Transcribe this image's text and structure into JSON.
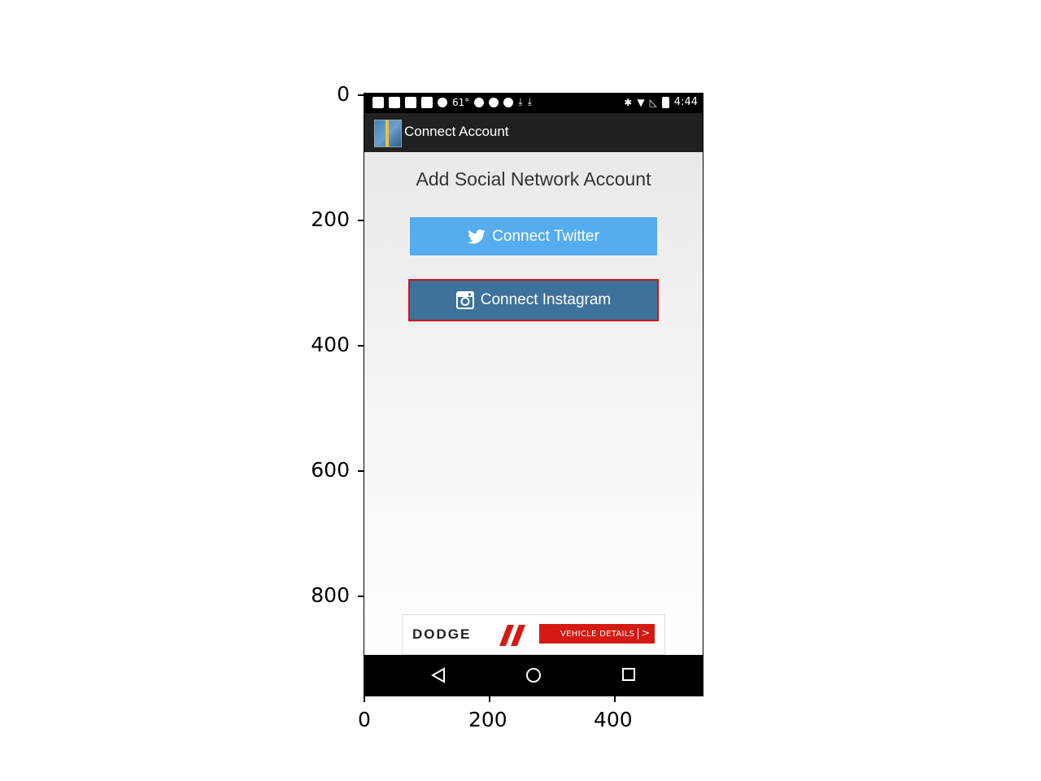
{
  "axes": {
    "y_ticks": [
      "0",
      "200",
      "400",
      "600",
      "800"
    ],
    "x_ticks": [
      "0",
      "200",
      "400"
    ]
  },
  "status_bar": {
    "temperature": "61°",
    "time": "4:44"
  },
  "action_bar": {
    "title": "Connect Account",
    "app_icon": "app-logo-icon"
  },
  "main": {
    "heading": "Add Social Network Account",
    "twitter_button": {
      "label": "Connect Twitter",
      "icon": "twitter-bird-icon",
      "color": "#55acee"
    },
    "instagram_button": {
      "label": "Connect Instagram",
      "icon": "instagram-camera-icon",
      "color": "#3f729b",
      "highlight": "#d0141b"
    }
  },
  "ad": {
    "brand": "DODGE",
    "cta": "VEHICLE DETAILS",
    "arrow": ">",
    "cta_color": "#d41a12"
  },
  "nav_bar": {
    "back_icon": "back-triangle-icon",
    "home_icon": "home-circle-icon",
    "recents_icon": "recents-square-icon"
  }
}
